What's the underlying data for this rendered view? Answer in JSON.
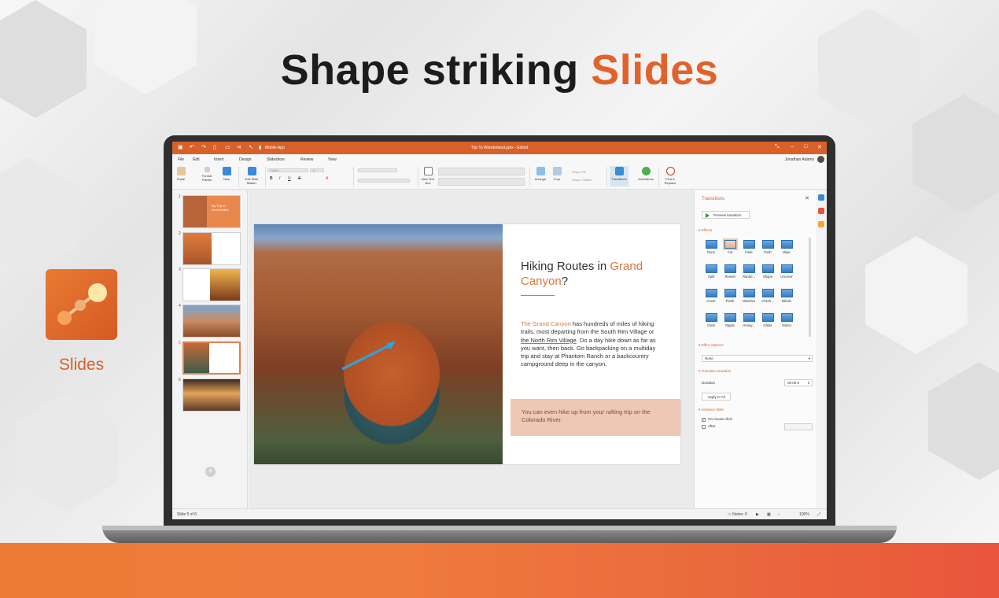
{
  "hero": {
    "headline_plain": "Shape striking ",
    "headline_accent": "Slides",
    "app_name": "Slides"
  },
  "window": {
    "app_label": "Mobile App",
    "doc_title": "Trip To Wonderland.pptx - Edited",
    "user_name": "Jonathan Adams"
  },
  "menu": [
    "File",
    "Edit",
    "Insert",
    "Design",
    "Slideshow",
    "Review",
    "View"
  ],
  "ribbon": {
    "paste": "Paste",
    "format_painter": "Format Painter",
    "new": "New",
    "edit_master": "Edit Slide Master",
    "font_name": "Calibri",
    "font_size": "11",
    "new_text_box": "New Text Box",
    "arrange": "Arrange",
    "crop": "Crop",
    "shape_fill": "Shape Fill",
    "shape_outline": "Shape Outline",
    "transitions": "Transitions",
    "animations": "Animations",
    "find_replace": "Find & Replace"
  },
  "thumbnails": [
    {
      "num": "1",
      "title": "My Trip to Wonderland"
    },
    {
      "num": "2",
      "title": ""
    },
    {
      "num": "3",
      "title": ""
    },
    {
      "num": "4",
      "title": ""
    },
    {
      "num": "5",
      "title": ""
    },
    {
      "num": "6",
      "title": ""
    }
  ],
  "slide": {
    "title_plain": "Hiking Routes in ",
    "title_accent": "Grand Canyon",
    "title_end": "?",
    "body_accent": "The Grand Canyon",
    "body_1": " has hundreds of miles of hiking trails, most departing from the South Rim Village or ",
    "body_link": "the North Rim Village",
    "body_2": ". Do a day hike down as far as you want, then back. Go backpacking on a multiday trip and stay at Phantom Ranch or a backcountry campground deep in the canyon.",
    "callout": "You can even hike up from your rafting trip on the Colorado River."
  },
  "transitions_panel": {
    "title": "Transitions",
    "preview": "Preview transition",
    "effects_label": "Effects",
    "effects": [
      "None",
      "Cut",
      "Fade",
      "Push",
      "Wipe",
      "Split",
      "Reveal",
      "Rando...",
      "Shape",
      "Uncover",
      "Cover",
      "Flash",
      "Dissolve",
      "Check...",
      "Blinds",
      "Clock",
      "Ripple",
      "Honey...",
      "Glitter",
      "Vortex"
    ],
    "effect_options_label": "Effect Options",
    "effect_option_value": "None",
    "duration_section": "Transition Duration",
    "duration_label": "Duration",
    "duration_value": "00:00.5",
    "apply_all": "Apply to All",
    "advance_label": "Advance Slide",
    "on_click": "On mouse click",
    "after": "After"
  },
  "status": {
    "slide_of": "Slide 5 of 6",
    "notes": "Notes: 0",
    "zoom": "100%"
  },
  "colors": {
    "accent": "#d8612a",
    "effect_blue": "#2f7ec6",
    "callout_bg": "#eec7b5"
  }
}
